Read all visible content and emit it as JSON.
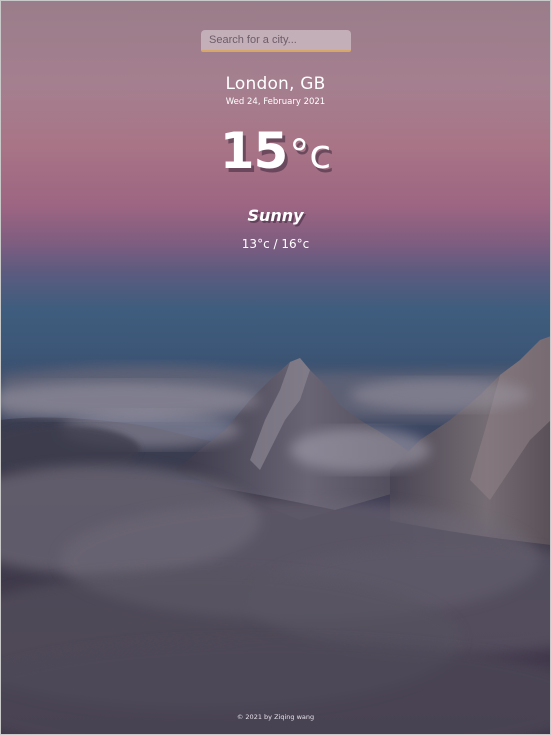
{
  "search": {
    "placeholder": "Search for a city...",
    "value": ""
  },
  "weather": {
    "location": "London, GB",
    "date": "Wed 24, February 2021",
    "temperature": "15",
    "temperature_unit": "°c",
    "condition": "Sunny",
    "range": "13°c / 16°c"
  },
  "footer": {
    "text": "© 2021 by Ziqing wang"
  },
  "colors": {
    "text": "#ffffff",
    "search_accent": "#d6a766"
  }
}
